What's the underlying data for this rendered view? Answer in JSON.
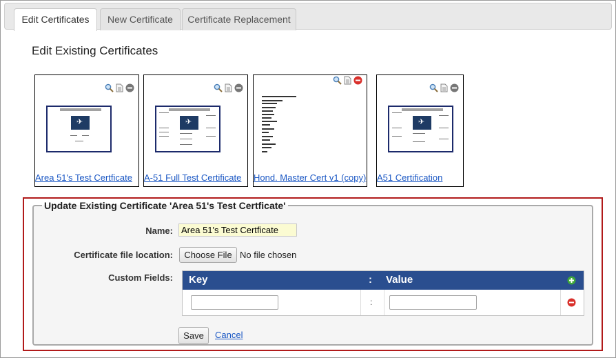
{
  "tabs": [
    "Edit Certificates",
    "New Certificate",
    "Certificate Replacement"
  ],
  "section_title": "Edit Existing Certificates",
  "certificates": [
    {
      "label": "Area 51's Test Certficate",
      "delete_active": false
    },
    {
      "label": "A-51 Full Test Certificate",
      "delete_active": false
    },
    {
      "label": "Hond. Master Cert v1 (copy)",
      "delete_active": true
    },
    {
      "label": "A51 Certification",
      "delete_active": false
    }
  ],
  "icons": {
    "preview": "magnifier-icon",
    "document": "document-icon",
    "remove": "minus-circle-icon",
    "add_row": "plus-circle-icon"
  },
  "update_panel": {
    "legend": "Update Existing Certificate 'Area 51's Test Certficate'",
    "name_label": "Name:",
    "name_value": "Area 51's Test Certficate",
    "file_label": "Certificate file location:",
    "file_button": "Choose File",
    "file_status": "No file chosen",
    "custom_fields_label": "Custom Fields:",
    "table": {
      "key_header": "Key",
      "separator": ":",
      "value_header": "Value",
      "rows": [
        {
          "key": "",
          "value": ""
        }
      ]
    },
    "save_label": "Save",
    "cancel_label": "Cancel"
  },
  "colors": {
    "table_header": "#2a4e8f",
    "highlight_box": "#b11a1a",
    "link": "#1a57c4",
    "add_green": "#3fa73a",
    "remove_red": "#d9302b"
  }
}
